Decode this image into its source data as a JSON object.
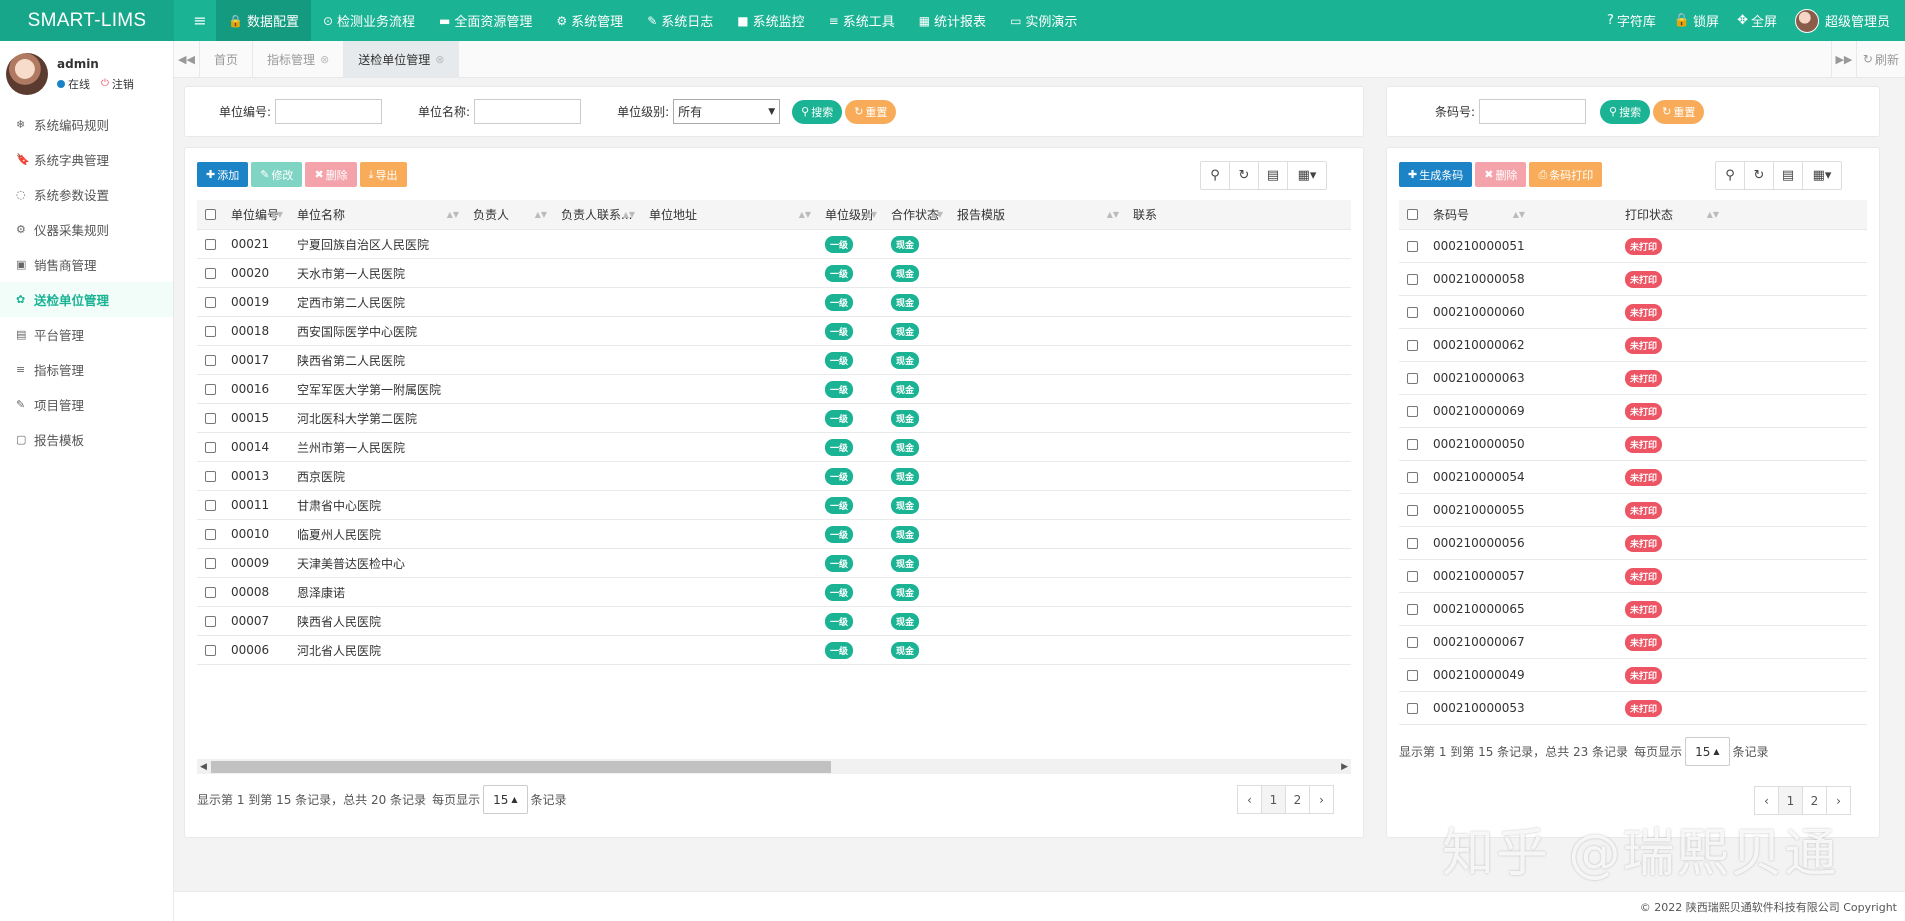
{
  "brand": "SMART-LIMS",
  "topnav": [
    {
      "icon": "🔒",
      "label": "数据配置",
      "active": true
    },
    {
      "icon": "⊙",
      "label": "检测业务流程"
    },
    {
      "icon": "▬",
      "label": "全面资源管理"
    },
    {
      "icon": "⚙",
      "label": "系统管理"
    },
    {
      "icon": "✎",
      "label": "系统日志"
    },
    {
      "icon": "■",
      "label": "系统监控"
    },
    {
      "icon": "≡",
      "label": "系统工具"
    },
    {
      "icon": "▦",
      "label": "统计报表"
    },
    {
      "icon": "▭",
      "label": "实例演示"
    }
  ],
  "topright": {
    "dict": "字符库",
    "lock": "锁屏",
    "fullscreen": "全屏",
    "user": "超级管理员"
  },
  "sidebar": {
    "username": "admin",
    "status": "在线",
    "logout": "注销",
    "items": [
      {
        "icon": "❄",
        "label": "系统编码规则"
      },
      {
        "icon": "🔖",
        "label": "系统字典管理"
      },
      {
        "icon": "◌",
        "label": "系统参数设置"
      },
      {
        "icon": "⚙",
        "label": "仪器采集规则"
      },
      {
        "icon": "▣",
        "label": "销售商管理"
      },
      {
        "icon": "✿",
        "label": "送检单位管理",
        "active": true
      },
      {
        "icon": "▤",
        "label": "平台管理"
      },
      {
        "icon": "≡",
        "label": "指标管理"
      },
      {
        "icon": "✎",
        "label": "项目管理"
      },
      {
        "icon": "▢",
        "label": "报告模板"
      }
    ]
  },
  "tabs": [
    {
      "label": "首页"
    },
    {
      "label": "指标管理",
      "closable": true
    },
    {
      "label": "送检单位管理",
      "closable": true,
      "active": true
    }
  ],
  "refresh": "刷新",
  "left": {
    "search": {
      "code_label": "单位编号:",
      "name_label": "单位名称:",
      "level_label": "单位级别:",
      "level_value": "所有",
      "search_btn": "搜索",
      "reset_btn": "重置"
    },
    "toolbar": {
      "add": "添加",
      "edit": "修改",
      "delete": "删除",
      "export": "导出"
    },
    "columns": [
      "单位编号",
      "单位名称",
      "负责人",
      "负责人联系...",
      "单位地址",
      "单位级别",
      "合作状态",
      "报告模版",
      "联系"
    ],
    "rows": [
      [
        "00021",
        "宁夏回族自治区人民医院",
        "一级",
        "现金"
      ],
      [
        "00020",
        "天水市第一人民医院",
        "一级",
        "现金"
      ],
      [
        "00019",
        "定西市第二人民医院",
        "一级",
        "现金"
      ],
      [
        "00018",
        "西安国际医学中心医院",
        "一级",
        "现金"
      ],
      [
        "00017",
        "陕西省第二人民医院",
        "一级",
        "现金"
      ],
      [
        "00016",
        "空军军医大学第一附属医院",
        "一级",
        "现金"
      ],
      [
        "00015",
        "河北医科大学第二医院",
        "一级",
        "现金"
      ],
      [
        "00014",
        "兰州市第一人民医院",
        "一级",
        "现金"
      ],
      [
        "00013",
        "西京医院",
        "一级",
        "现金"
      ],
      [
        "00011",
        "甘肃省中心医院",
        "一级",
        "现金"
      ],
      [
        "00010",
        "临夏州人民医院",
        "一级",
        "现金"
      ],
      [
        "00009",
        "天津美普达医检中心",
        "一级",
        "现金"
      ],
      [
        "00008",
        "恩泽康诺",
        "一级",
        "现金"
      ],
      [
        "00007",
        "陕西省人民医院",
        "一级",
        "现金"
      ],
      [
        "00006",
        "河北省人民医院",
        "一级",
        "现金"
      ]
    ],
    "pagination": {
      "info_prefix": "显示第 1 到第 15 条记录，总共 20 条记录",
      "per_page_label": "每页显示",
      "per_page": "15",
      "suffix": "条记录",
      "pages": [
        "‹",
        "1",
        "2",
        "›"
      ]
    }
  },
  "right": {
    "search": {
      "code_label": "条码号:",
      "search_btn": "搜索",
      "reset_btn": "重置"
    },
    "toolbar": {
      "generate": "生成条码",
      "delete": "删除",
      "print": "条码打印"
    },
    "columns": [
      "条码号",
      "打印状态"
    ],
    "rows": [
      [
        "000210000051",
        "未打印"
      ],
      [
        "000210000058",
        "未打印"
      ],
      [
        "000210000060",
        "未打印"
      ],
      [
        "000210000062",
        "未打印"
      ],
      [
        "000210000063",
        "未打印"
      ],
      [
        "000210000069",
        "未打印"
      ],
      [
        "000210000050",
        "未打印"
      ],
      [
        "000210000054",
        "未打印"
      ],
      [
        "000210000055",
        "未打印"
      ],
      [
        "000210000056",
        "未打印"
      ],
      [
        "000210000057",
        "未打印"
      ],
      [
        "000210000065",
        "未打印"
      ],
      [
        "000210000067",
        "未打印"
      ],
      [
        "000210000049",
        "未打印"
      ],
      [
        "000210000053",
        "未打印"
      ]
    ],
    "pagination": {
      "info_prefix": "显示第 1 到第 15 条记录，总共 23 条记录",
      "per_page_label": "每页显示",
      "per_page": "15",
      "suffix": "条记录",
      "pages": [
        "‹",
        "1",
        "2",
        "›"
      ]
    }
  },
  "footer": "© 2022 陕西瑞熙贝通软件科技有限公司 Copyright",
  "watermark": "知乎 @瑞熙贝通"
}
